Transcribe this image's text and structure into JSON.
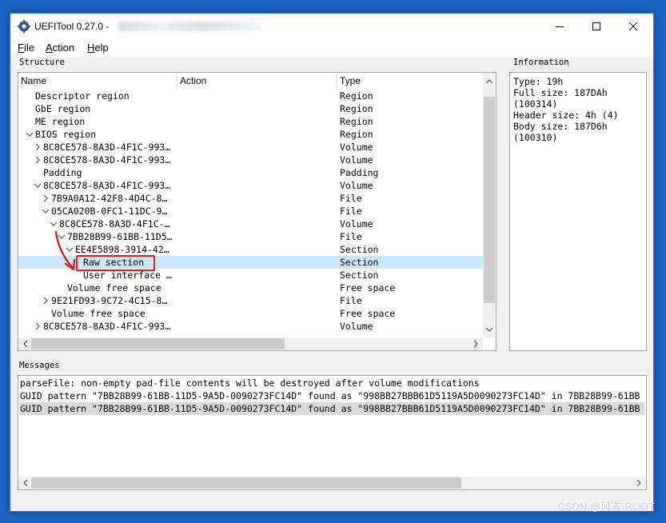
{
  "window": {
    "title": "UEFITool 0.27.0 -",
    "minimize_icon": "minimize-icon",
    "maximize_icon": "maximize-icon",
    "close_icon": "close-icon"
  },
  "menu": [
    {
      "label": "File",
      "accel": "F",
      "rest": "ile"
    },
    {
      "label": "Action",
      "accel": "A",
      "rest": "ction"
    },
    {
      "label": "Help",
      "accel": "H",
      "rest": "elp"
    }
  ],
  "structure": {
    "label": "Structure",
    "columns": [
      "Name",
      "Action",
      "Type"
    ],
    "rows": [
      {
        "name": "Descriptor region",
        "type": "Region"
      },
      {
        "name": "GbE region",
        "type": "Region"
      },
      {
        "name": "ME region",
        "type": "Region"
      },
      {
        "name": "BIOS region",
        "type": "Region"
      },
      {
        "name": "8C8CE578-8A3D-4F1C-993…",
        "type": "Volume"
      },
      {
        "name": "8C8CE578-8A3D-4F1C-993…",
        "type": "Volume"
      },
      {
        "name": "Padding",
        "type": "Padding"
      },
      {
        "name": "8C8CE578-8A3D-4F1C-993…",
        "type": "Volume"
      },
      {
        "name": "7B9A0A12-42F8-4D4C-8…",
        "type": "File"
      },
      {
        "name": "05CA020B-0FC1-11DC-9…",
        "type": "File"
      },
      {
        "name": "8C8CE578-8A3D-4F1C-…",
        "type": "Volume"
      },
      {
        "name": "7BB28B99-61BB-11D5…",
        "type": "File"
      },
      {
        "name": "EE4E5898-3914-42…",
        "type": "Section"
      },
      {
        "name": "Raw section",
        "type": "Section"
      },
      {
        "name": "User interface …",
        "type": "Section"
      },
      {
        "name": "Volume free space",
        "type": "Free space"
      },
      {
        "name": "9E21FD93-9C72-4C15-8…",
        "type": "File"
      },
      {
        "name": "Volume free space",
        "type": "Free space"
      },
      {
        "name": "8C8CE578-8A3D-4F1C-993…",
        "type": "Volume"
      }
    ]
  },
  "information": {
    "label": "Information",
    "lines": [
      "Type: 19h",
      "Full size: 187DAh",
      "(100314)",
      "Header size: 4h (4)",
      "Body size: 187D6h",
      "(100310)"
    ]
  },
  "messages": {
    "label": "Messages",
    "lines": [
      "parseFile: non-empty pad-file contents will be destroyed after volume modifications",
      "GUID pattern \"7BB28B99-61BB-11D5-9A5D-0090273FC14D\" found as \"998BB27BBB61D5119A5D0090273FC14D\" in 7BB28B99-61BB",
      "GUID pattern \"7BB28B99-61BB-11D5-9A5D-0090273FC14D\" found as \"998BB27BBB61D5119A5D0090273FC14D\" in 7BB28B99-61BB"
    ]
  },
  "watermark": "CSDN @风言-ROOT",
  "colors": {
    "selection": "#cce8ff",
    "annotation": "#e02020",
    "desktop": "#1b63c2"
  }
}
